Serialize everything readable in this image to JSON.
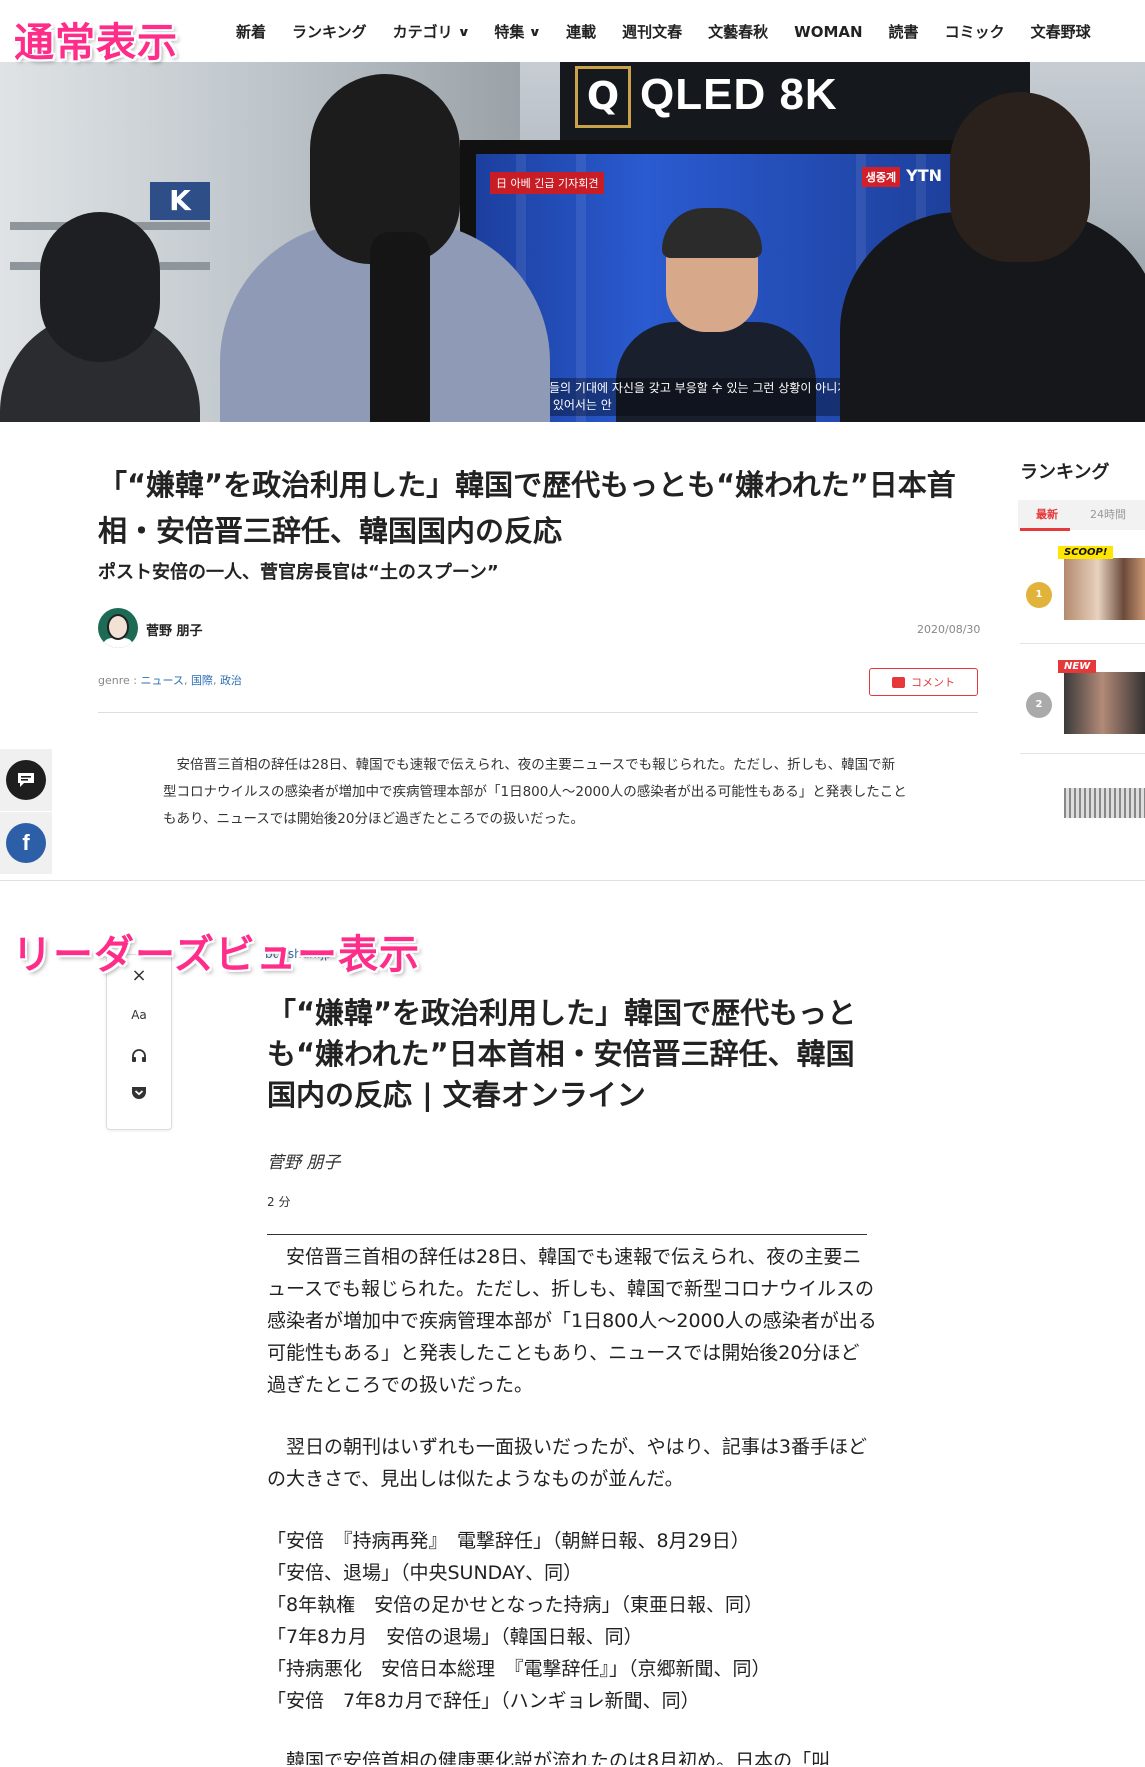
{
  "labels": {
    "normal_view": "通常表示",
    "reader_view": "リーダーズビュー表示"
  },
  "nav": {
    "items": [
      {
        "label": "新着",
        "dropdown": false
      },
      {
        "label": "ランキング",
        "dropdown": false
      },
      {
        "label": "カテゴリ",
        "dropdown": true
      },
      {
        "label": "特集",
        "dropdown": true
      },
      {
        "label": "連載",
        "dropdown": false
      },
      {
        "label": "週刊文春",
        "dropdown": false
      },
      {
        "label": "文藝春秋",
        "dropdown": false
      },
      {
        "label": "WOMAN",
        "dropdown": false
      },
      {
        "label": "読書",
        "dropdown": false
      },
      {
        "label": "コミック",
        "dropdown": false
      },
      {
        "label": "文春野球",
        "dropdown": false
      }
    ]
  },
  "hero": {
    "qled_text": "QLED 8K",
    "qled_box": "Q",
    "sign": "K",
    "ytn": "YTN",
    "ytn_badge": "생중계",
    "tv_tag": "日 아베 긴급 기자회견",
    "tv_caption": "국민 여러분들의 기대에 자신을 갖고 부응할 수 있는 그런 상황이 아니게 된 이상 총리라는 자리에 계속 있어서는 안"
  },
  "article": {
    "title": "「“嫌韓”を政治利用した」韓国で歴代もっとも“嫌われた”日本首相・安倍晋三辞任、韓国国内の反応",
    "subtitle": "ポスト安倍の一人、菅官房長官は“土のスプーン”",
    "author": "菅野 朋子",
    "date": "2020/08/30",
    "genre_label": "genre : ",
    "genres": [
      "ニュース",
      "国際",
      "政治"
    ],
    "comment_label": "コメント",
    "body": "　安倍晋三首相の辞任は28日、韓国でも速報で伝えられ、夜の主要ニュースでも報じられた。ただし、折しも、韓国で新型コロナウイルスの感染者が増加中で疾病管理本部が「1日800人～2000人の感染者が出る可能性もある」と発表したこともあり、ニュースでは開始後20分ほど過ぎたところでの扱いだった。"
  },
  "sidebar": {
    "ranking_title": "ランキング",
    "tab_latest": "最新",
    "tab_24h": "24時間",
    "items": [
      {
        "rank": "1",
        "tag": "SCOOP!"
      },
      {
        "rank": "2",
        "tag": "NEW"
      },
      {
        "rank": "3",
        "tag": ""
      }
    ]
  },
  "social": {
    "comment_icon": "comment-bubble-icon",
    "facebook_icon": "f"
  },
  "reader": {
    "site_label": "bunshun.jp",
    "close": "×",
    "font_settings": "Aa",
    "listen_icon": "headphones-icon",
    "pocket_icon": "pocket-icon",
    "title": "「“嫌韓”を政治利用した」韓国で歴代もっとも“嫌われた”日本首相・安倍晋三辞任、韓国国内の反応 | 文春オンライン",
    "author": "菅野 朋子",
    "reading_time": "2 分",
    "paragraphs": [
      "　安倍晋三首相の辞任は28日、韓国でも速報で伝えられ、夜の主要ニュースでも報じられた。ただし、折しも、韓国で新型コロナウイルスの感染者が増加中で疾病管理本部が「1日800人～2000人の感染者が出る可能性もある」と発表したこともあり、ニュースでは開始後20分ほど過ぎたところでの扱いだった。",
      "　翌日の朝刊はいずれも一面扱いだったが、やはり、記事は3番手ほどの大きさで、見出しは似たようなものが並んだ。"
    ],
    "headlines": [
      "「安倍　『持病再発』　電撃辞任」（朝鮮日報、8月29日）",
      "「安倍、退場」（中央SUNDAY、同）",
      "「8年執権　安倍の足かせとなった持病」（東亜日報、同）",
      "「7年8カ月　安倍の退場」（韓国日報、同）",
      "「持病悪化　安倍日本総理　『電撃辞任』」（京郷新聞、同）",
      "「安倍　7年8カ月で辞任」（ハンギョレ新聞、同）"
    ],
    "cutoff": "　韓国で安倍首相の健康悪化説が流れたのは8月初め。日本の「叫"
  },
  "colors": {
    "accent_pink": "#ff2d8a",
    "accent_red": "#e5383b",
    "link_blue": "#2e6fb5",
    "facebook_blue": "#2d5ea8"
  }
}
